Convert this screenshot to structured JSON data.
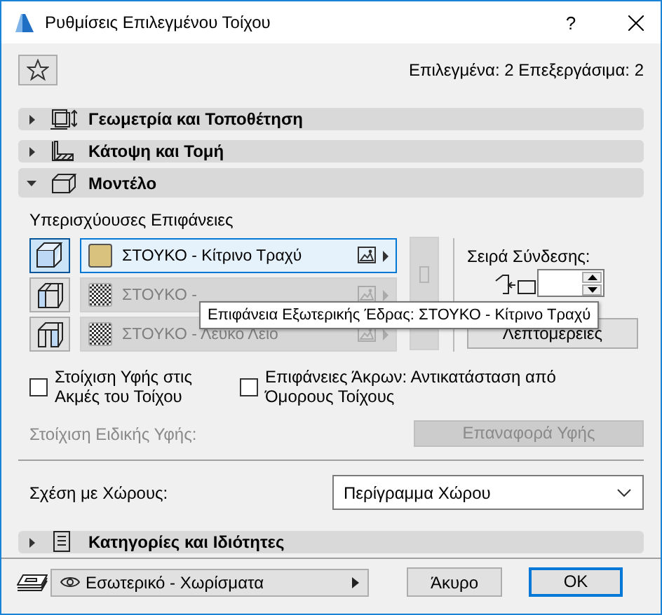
{
  "window": {
    "title": "Ρυθμίσεις Επιλεγμένου Τοίχου",
    "help": "?"
  },
  "selection_info": "Επιλεγμένα: 2 Επεξεργάσιμα: 2",
  "sections": [
    {
      "title": "Γεωμετρία και Τοποθέτηση",
      "kind": "geometry",
      "expanded": false
    },
    {
      "title": "Κάτοψη και Τομή",
      "kind": "plan",
      "expanded": false
    },
    {
      "title": "Μοντέλο",
      "kind": "model",
      "expanded": true
    }
  ],
  "model": {
    "overrides_label": "Υπερισχύουσες Επιφάνειες",
    "surfaces": [
      {
        "name": "ΣΤΟΥΚΟ - Κίτρινο Τραχύ",
        "kind": "outside",
        "override": true,
        "color": "#d9c27e"
      },
      {
        "name": "ΣΤΟΥΚΟ -",
        "kind": "edge",
        "override": false
      },
      {
        "name": "ΣΤΟΥΚΟ - Λευκό Λείο",
        "kind": "inside",
        "override": false
      }
    ],
    "order_slider": {
      "level": 0.3
    },
    "connection_order_label": "Σειρά Σύνδεσης:",
    "details_button": "Λεπτομέρειες",
    "tooltip": "Επιφάνεια Εξωτερικής Έδρας: ΣΤΟΥΚΟ - Κίτρινο Τραχύ",
    "checkboxes": [
      {
        "label": "Στοίχιση Υφής στις Ακμές του Τοίχου",
        "checked": false
      },
      {
        "label": "Επιφάνειες Άκρων: Αντικατάσταση από Όμορους Τοίχους",
        "checked": false
      }
    ],
    "custom_texture_label": "Στοίχιση Ειδικής Υφής:",
    "reset_texture_button": {
      "label": "Επαναφορά Υφής",
      "disabled": true
    },
    "zones_label": "Σχέση με Χώρους:",
    "zones_value": "Περίγραμμα Χώρου"
  },
  "sections_after": [
    {
      "title": "Κατηγορίες και Ιδιότητες",
      "kind": "properties",
      "expanded": false
    }
  ],
  "footer": {
    "layer": "Εσωτερικό - Χωρίσματα",
    "cancel": "Άκυρο",
    "ok": "OK"
  }
}
